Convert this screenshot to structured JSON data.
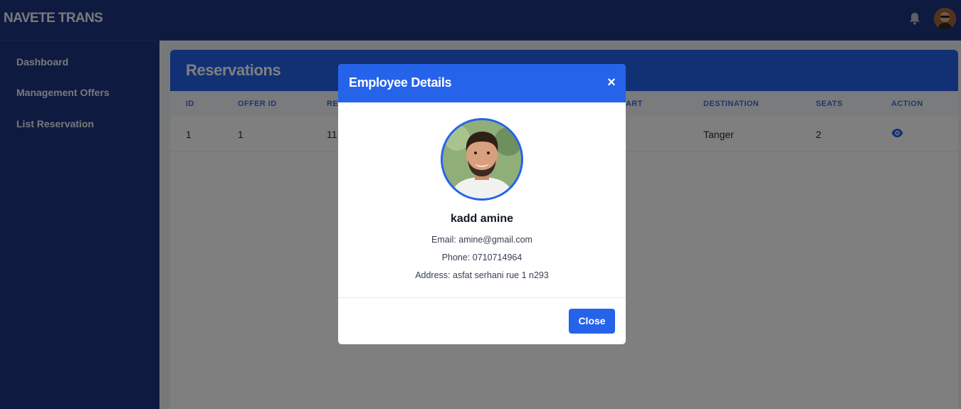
{
  "app": {
    "brand": "NAVETE TRANS"
  },
  "topbar": {
    "notification_icon": "bell-icon",
    "avatar_icon": "user-avatar"
  },
  "sidebar": {
    "items": [
      {
        "label": "Dashboard"
      },
      {
        "label": "Management Offers"
      },
      {
        "label": "List Reservation"
      }
    ]
  },
  "main": {
    "title": "Reservations",
    "table": {
      "columns": [
        "ID",
        "OFFER ID",
        "RE",
        "ART",
        "DESTINATION",
        "SEATS",
        "ACTION"
      ],
      "rows": [
        {
          "id": "1",
          "offer_id": "1",
          "reservation": "11",
          "destination": "Tanger",
          "seats": "2",
          "action_icon": "eye-icon"
        }
      ]
    }
  },
  "modal": {
    "title": "Employee Details",
    "close_symbol": "×",
    "employee": {
      "name": "kadd amine",
      "email": "Email: amine@gmail.com",
      "phone": "Phone: 0710714964",
      "address": "Address: asfat serhani rue 1 n293"
    },
    "close_button": "Close"
  },
  "colors": {
    "primary": "#2563eb",
    "navy": "#1c3580",
    "overlay": "rgba(0,0,0,0.5)"
  }
}
